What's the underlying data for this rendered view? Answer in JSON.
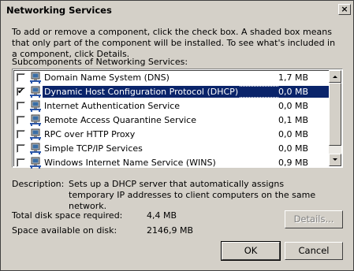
{
  "window": {
    "title": "Networking Services",
    "close_glyph": "×"
  },
  "intro_text": "To add or remove a component, click the check box. A shaded box means that only part of the component will be installed. To see what's included in a component, click Details.",
  "subcomponents_label": "Subcomponents of Networking Services:",
  "components": [
    {
      "name": "Domain Name System (DNS)",
      "size": "1,7 MB",
      "checked": false,
      "selected": false
    },
    {
      "name": "Dynamic Host Configuration Protocol (DHCP)",
      "size": "0,0 MB",
      "checked": true,
      "selected": true
    },
    {
      "name": "Internet Authentication Service",
      "size": "0,0 MB",
      "checked": false,
      "selected": false
    },
    {
      "name": "Remote Access Quarantine Service",
      "size": "0,1 MB",
      "checked": false,
      "selected": false
    },
    {
      "name": "RPC over HTTP Proxy",
      "size": "0,0 MB",
      "checked": false,
      "selected": false
    },
    {
      "name": "Simple TCP/IP Services",
      "size": "0,0 MB",
      "checked": false,
      "selected": false
    },
    {
      "name": "Windows Internet Name Service (WINS)",
      "size": "0,9 MB",
      "checked": false,
      "selected": false
    }
  ],
  "description": {
    "label": "Description:",
    "text": "Sets up a DHCP server that automatically assigns temporary IP addresses to client computers on the same network."
  },
  "disk": {
    "required_label": "Total disk space required:",
    "required_value": "4,4 MB",
    "available_label": "Space available on disk:",
    "available_value": "2146,9 MB"
  },
  "buttons": {
    "details": "Details...",
    "ok": "OK",
    "cancel": "Cancel"
  },
  "colors": {
    "selection": "#0a246a",
    "face": "#d4d0c8"
  },
  "icons": {
    "component": "network-service-icon",
    "check": "✔"
  }
}
